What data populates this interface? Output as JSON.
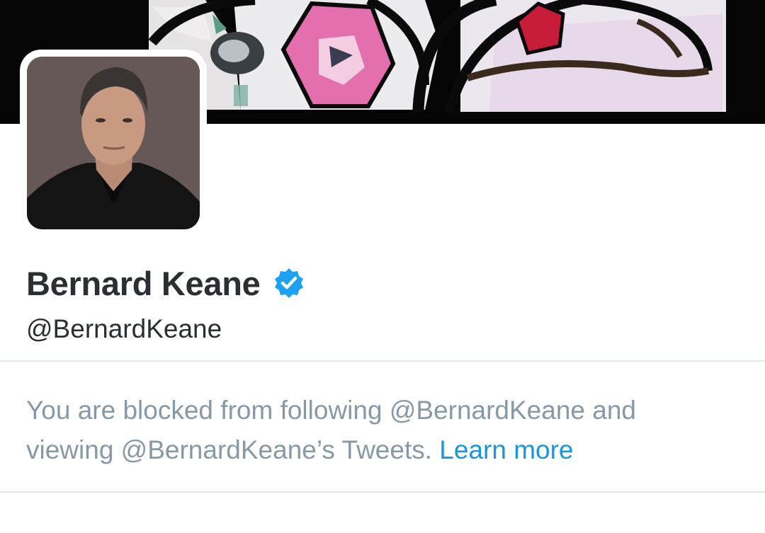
{
  "profile": {
    "display_name": "Bernard Keane",
    "handle": "@BernardKeane",
    "verified": true,
    "avatar_icon": "profile-photo"
  },
  "banner": {
    "icon": "stained-glass-header-image"
  },
  "blocked": {
    "message_line1": "You are blocked from following @BernardKeane and",
    "message_line2": "viewing @BernardKeane’s Tweets.",
    "learn_more_label": "Learn more"
  },
  "colors": {
    "verified_badge": "#1da1f2",
    "link": "#1b95e0",
    "muted_text": "#8899a6",
    "primary_text": "#292f33",
    "divider": "#e1e8ed"
  }
}
